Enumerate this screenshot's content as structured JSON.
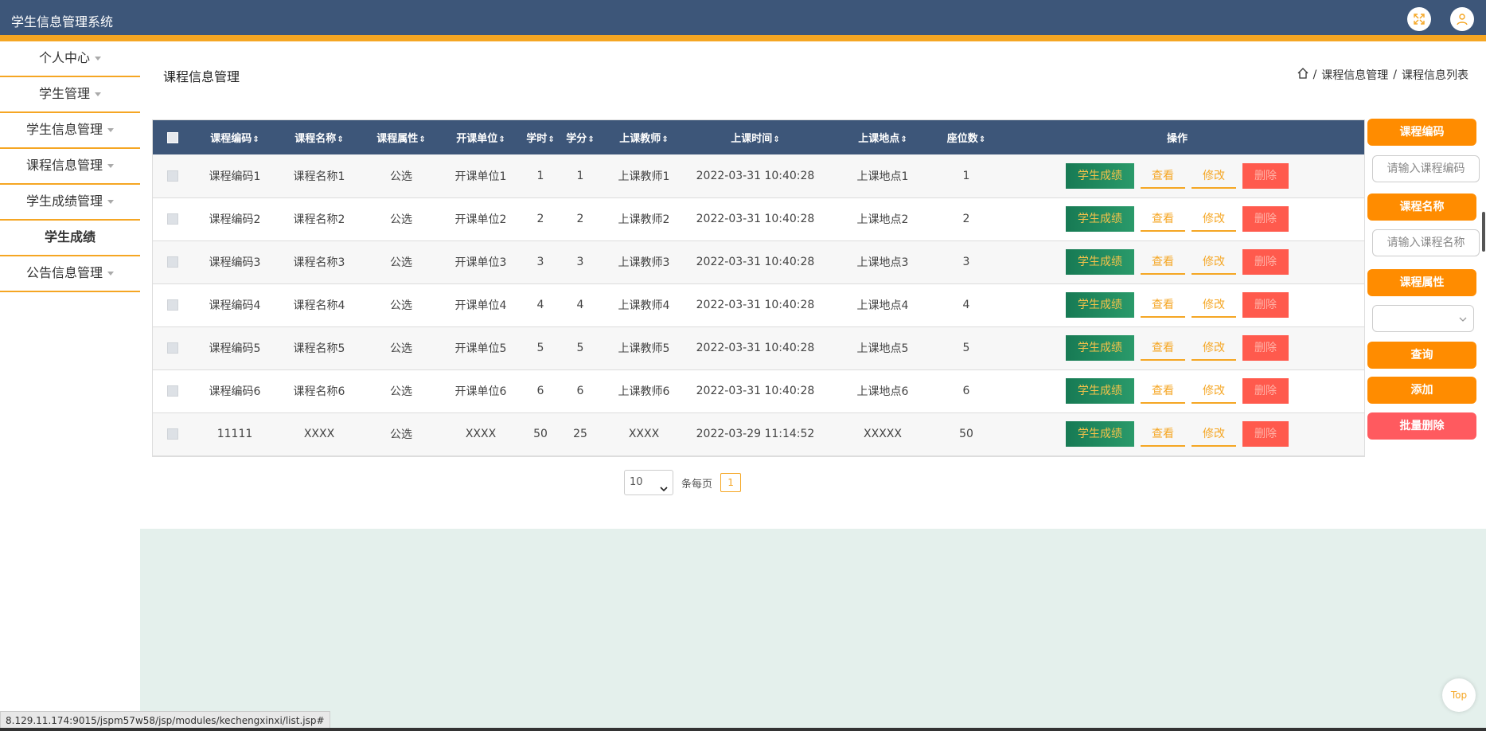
{
  "header": {
    "title": "学生信息管理系统"
  },
  "sidebar": {
    "items": [
      {
        "label": "个人中心"
      },
      {
        "label": "学生管理"
      },
      {
        "label": "学生信息管理"
      },
      {
        "label": "课程信息管理"
      },
      {
        "label": "学生成绩管理"
      }
    ],
    "sub_item": "学生成绩",
    "last_item": "公告信息管理"
  },
  "page": {
    "title": "课程信息管理",
    "breadcrumb": {
      "sep1": "/",
      "item1": "课程信息管理",
      "sep2": "/",
      "item2": "课程信息列表"
    }
  },
  "table": {
    "headers": [
      "课程编码",
      "课程名称",
      "课程属性",
      "开课单位",
      "学时",
      "学分",
      "上课教师",
      "上课时间",
      "上课地点",
      "座位数",
      "操作"
    ],
    "sort_glyph": "⇕",
    "rows": [
      [
        "课程编码1",
        "课程名称1",
        "公选",
        "开课单位1",
        "1",
        "1",
        "上课教师1",
        "2022-03-31 10:40:28",
        "上课地点1",
        "1"
      ],
      [
        "课程编码2",
        "课程名称2",
        "公选",
        "开课单位2",
        "2",
        "2",
        "上课教师2",
        "2022-03-31 10:40:28",
        "上课地点2",
        "2"
      ],
      [
        "课程编码3",
        "课程名称3",
        "公选",
        "开课单位3",
        "3",
        "3",
        "上课教师3",
        "2022-03-31 10:40:28",
        "上课地点3",
        "3"
      ],
      [
        "课程编码4",
        "课程名称4",
        "公选",
        "开课单位4",
        "4",
        "4",
        "上课教师4",
        "2022-03-31 10:40:28",
        "上课地点4",
        "4"
      ],
      [
        "课程编码5",
        "课程名称5",
        "公选",
        "开课单位5",
        "5",
        "5",
        "上课教师5",
        "2022-03-31 10:40:28",
        "上课地点5",
        "5"
      ],
      [
        "课程编码6",
        "课程名称6",
        "公选",
        "开课单位6",
        "6",
        "6",
        "上课教师6",
        "2022-03-31 10:40:28",
        "上课地点6",
        "6"
      ],
      [
        "11111",
        "XXXX",
        "公选",
        "XXXX",
        "50",
        "25",
        "XXXX",
        "2022-03-29 11:14:52",
        "XXXXX",
        "50"
      ]
    ],
    "actions": {
      "grade": "学生成绩",
      "view": "查看",
      "edit": "修改",
      "delete": "删除"
    }
  },
  "search_panel": {
    "code_label": "课程编码",
    "code_placeholder": "请输入课程编码",
    "name_label": "课程名称",
    "name_placeholder": "请输入课程名称",
    "attr_label": "课程属性",
    "query_button": "查询",
    "add_button": "添加",
    "batch_delete_button": "批量删除"
  },
  "pagination": {
    "page_size": "10",
    "per_page_label": "条每页",
    "current_page": "1"
  },
  "status_url": "8.129.11.174:9015/jspm57w58/jsp/modules/kechengxinxi/list.jsp#",
  "top_button": "Top",
  "colors": {
    "header": "#3d5679",
    "accent": "#f5a623",
    "orange": "#ff8c00",
    "green": "#1b7f5a",
    "danger": "#ff5a4d"
  }
}
